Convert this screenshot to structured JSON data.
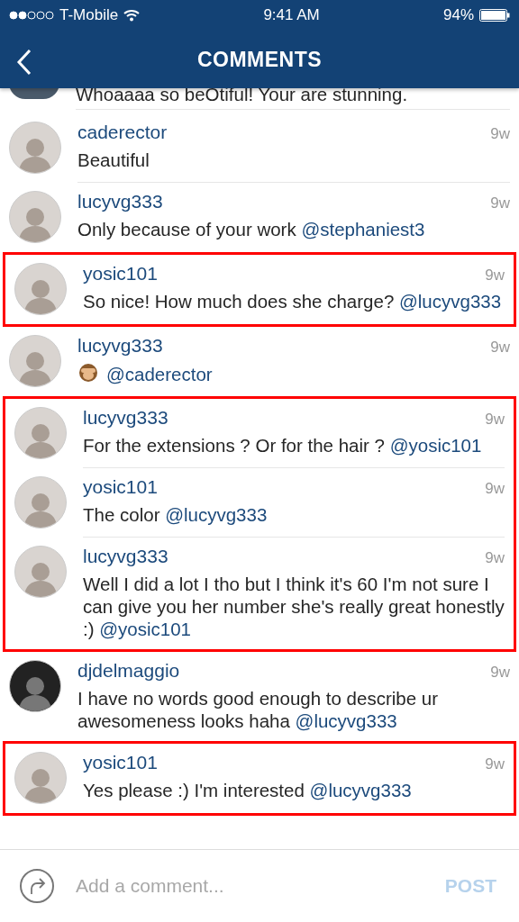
{
  "status_bar": {
    "carrier": "T-Mobile",
    "time": "9:41 AM",
    "battery": "94%"
  },
  "header": {
    "title": "COMMENTS"
  },
  "feed": [
    {
      "kind": "partial",
      "text": "Whoaaaa so beOtiful! Your are stunning."
    },
    {
      "kind": "comment",
      "user": "caderector",
      "time": "9w",
      "text": "Beautiful"
    },
    {
      "kind": "comment",
      "user": "lucyvg333",
      "time": "9w",
      "text": "Only because of your work",
      "mention": "@stephaniest3"
    },
    {
      "kind": "highlight",
      "comments": [
        {
          "user": "yosic101",
          "time": "9w",
          "text": "So nice! How much does she charge?",
          "mention": "@lucyvg333"
        }
      ]
    },
    {
      "kind": "comment",
      "user": "lucyvg333",
      "time": "9w",
      "emoji_icon": true,
      "mention": "@caderector"
    },
    {
      "kind": "highlight",
      "comments": [
        {
          "user": "lucyvg333",
          "time": "9w",
          "text": "For the extensions ? Or for the hair ?",
          "mention": "@yosic101"
        },
        {
          "user": "yosic101",
          "time": "9w",
          "text": "The color",
          "mention": "@lucyvg333"
        },
        {
          "user": "lucyvg333",
          "time": "9w",
          "text": "Well I did a lot I tho but I think it's 60 I'm not sure I can give you her number she's really great honestly :)",
          "mention": "@yosic101"
        }
      ]
    },
    {
      "kind": "comment",
      "user": "djdelmaggio",
      "time": "9w",
      "text": "I have no words good enough to describe ur awesomeness looks haha",
      "mention": "@lucyvg333",
      "dark_avatar": true
    },
    {
      "kind": "highlight",
      "comments": [
        {
          "user": "yosic101",
          "time": "9w",
          "text": "Yes please :) I'm interested",
          "mention": "@lucyvg333"
        }
      ]
    }
  ],
  "composer": {
    "placeholder": "Add a comment...",
    "post": "POST"
  }
}
